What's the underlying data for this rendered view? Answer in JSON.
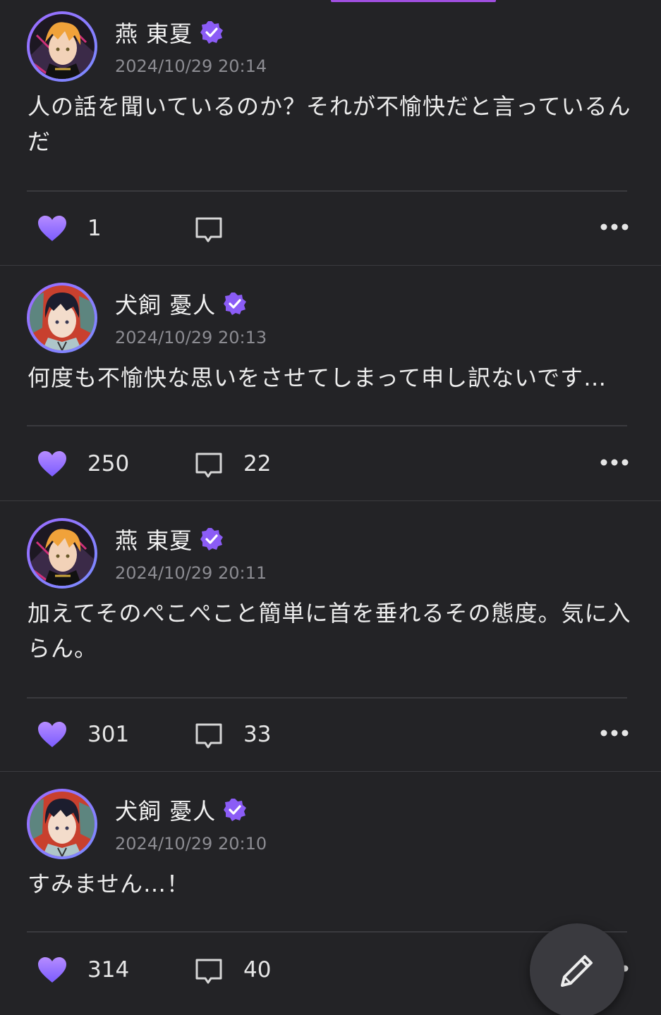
{
  "colors": {
    "background": "#232326",
    "accent": "#a04fe0",
    "verified": "#8b5cf6",
    "like_gradient_top": "#b68cff",
    "like_gradient_bottom": "#7b5cff",
    "timestamp": "#8c8c92"
  },
  "posts": [
    {
      "author": "燕 東夏",
      "verified_icon": "verified-badge-icon",
      "timestamp": "2024/10/29 20:14",
      "body": "人の話を聞いているのか？それが不愉快だと言っているんだ",
      "likes": "1",
      "comments": ""
    },
    {
      "author": "犬飼 憂人",
      "verified_icon": "verified-badge-icon",
      "timestamp": "2024/10/29 20:13",
      "body": "何度も不愉快な思いをさせてしまって申し訳ないです…",
      "likes": "250",
      "comments": "22"
    },
    {
      "author": "燕 東夏",
      "verified_icon": "verified-badge-icon",
      "timestamp": "2024/10/29 20:11",
      "body": "加えてそのぺこぺこと簡単に首を垂れるその態度。気に入らん。",
      "likes": "301",
      "comments": "33"
    },
    {
      "author": "犬飼 憂人",
      "verified_icon": "verified-badge-icon",
      "timestamp": "2024/10/29 20:10",
      "body": "すみません…！",
      "likes": "314",
      "comments": "40"
    }
  ],
  "icons": {
    "like": "heart-icon",
    "comment": "comment-bubble-icon",
    "more": "more-dots-icon",
    "compose": "pencil-icon"
  }
}
